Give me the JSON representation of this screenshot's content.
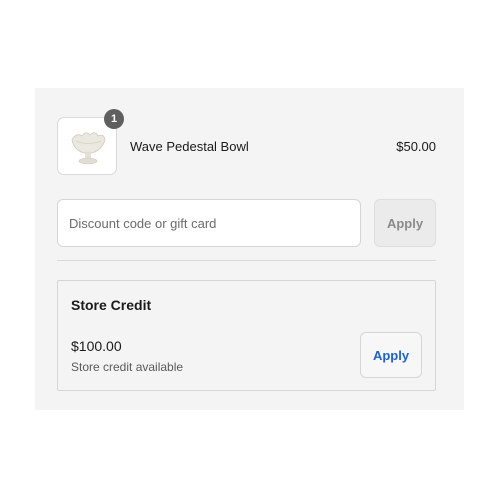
{
  "cart_item": {
    "quantity": "1",
    "name": "Wave Pedestal Bowl",
    "price": "$50.00",
    "image_icon": "pedestal-bowl-image"
  },
  "discount": {
    "placeholder": "Discount code or gift card",
    "value": "",
    "apply_label": "Apply"
  },
  "store_credit": {
    "title": "Store Credit",
    "amount": "$100.00",
    "subtitle": "Store credit available",
    "apply_label": "Apply"
  },
  "colors": {
    "panel_bg": "#f4f4f4",
    "accent_link": "#1f63c9",
    "badge_bg": "#5f5f5f"
  }
}
